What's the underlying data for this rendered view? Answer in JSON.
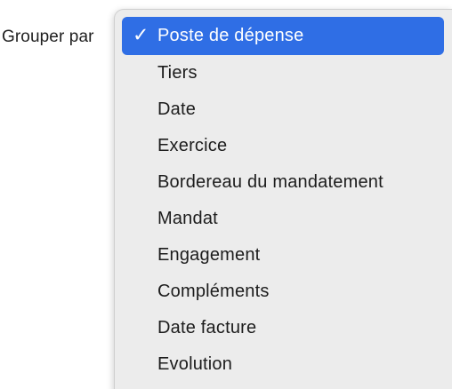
{
  "groupBy": {
    "label": "Grouper par",
    "selected": "Poste de dépense"
  },
  "menu": {
    "check_glyph": "✓",
    "items": [
      {
        "label": "Poste de dépense",
        "selected": true
      },
      {
        "label": "Tiers",
        "selected": false
      },
      {
        "label": "Date",
        "selected": false
      },
      {
        "label": "Exercice",
        "selected": false
      },
      {
        "label": "Bordereau du mandatement",
        "selected": false
      },
      {
        "label": "Mandat",
        "selected": false
      },
      {
        "label": "Engagement",
        "selected": false
      },
      {
        "label": "Compléments",
        "selected": false
      },
      {
        "label": "Date facture",
        "selected": false
      },
      {
        "label": "Evolution",
        "selected": false
      }
    ]
  },
  "colors": {
    "highlight": "#2f6ee5",
    "menu_background": "#ececec",
    "text": "#1c1c1c"
  }
}
